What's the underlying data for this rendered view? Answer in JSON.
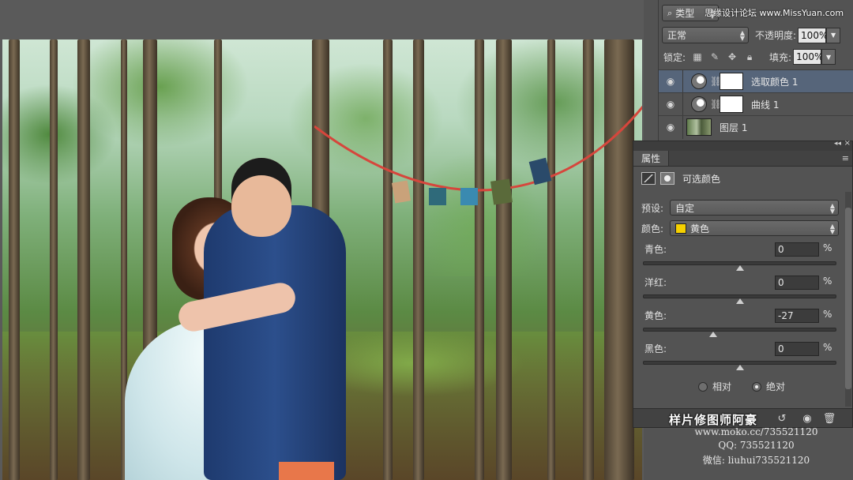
{
  "layers": {
    "filter_type": "类型",
    "blend_mode": "正常",
    "opacity_label": "不透明度:",
    "opacity_value": "100%",
    "lock_label": "锁定:",
    "fill_label": "填充:",
    "fill_value": "100%",
    "items": [
      {
        "name": "选取颜色 1",
        "kind": "adjustment",
        "selected": true
      },
      {
        "name": "曲线 1",
        "kind": "adjustment",
        "selected": false
      },
      {
        "name": "图层 1",
        "kind": "pixel",
        "selected": false
      }
    ]
  },
  "properties": {
    "tab": "属性",
    "title": "可选颜色",
    "preset_label": "预设:",
    "preset_value": "自定",
    "color_label": "颜色:",
    "color_value": "黄色",
    "color_swatch": "#f5d000",
    "sliders": [
      {
        "label": "青色:",
        "value": "0",
        "unit": "%",
        "percent": 0
      },
      {
        "label": "洋红:",
        "value": "0",
        "unit": "%",
        "percent": 0
      },
      {
        "label": "黄色:",
        "value": "-27",
        "unit": "%",
        "percent": -27
      },
      {
        "label": "黑色:",
        "value": "0",
        "unit": "%",
        "percent": 0
      }
    ],
    "mode_relative": "相对",
    "mode_absolute": "绝对",
    "mode_selected": "绝对",
    "footer_watermark": "样片修图师阿豪"
  },
  "watermark": {
    "top": "思缘设计论坛 www.MissYuan.com",
    "site": "www.moko.cc/735521120",
    "qq": "QQ: 735521120",
    "wechat": "微信: liuhui735521120"
  }
}
